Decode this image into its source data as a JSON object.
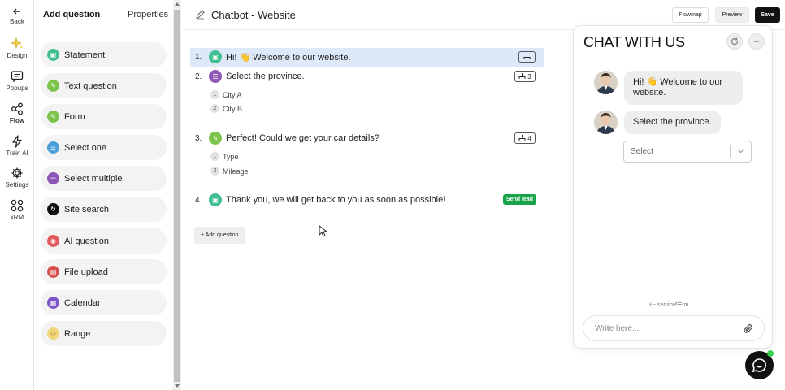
{
  "rail": {
    "back": "Back",
    "items": [
      {
        "label": "Design",
        "icon": "sparkle-icon"
      },
      {
        "label": "Popups",
        "icon": "chat-icon"
      },
      {
        "label": "Flow",
        "icon": "share-icon"
      },
      {
        "label": "Train AI",
        "icon": "bolt-icon"
      },
      {
        "label": "Settings",
        "icon": "gear-icon"
      },
      {
        "label": "xRM",
        "icon": "grid-icon"
      }
    ]
  },
  "palette": {
    "tab_add": "Add question",
    "tab_properties": "Properties",
    "items": [
      {
        "label": "Statement",
        "color": "#3fbf8f"
      },
      {
        "label": "Text question",
        "color": "#7cc34c"
      },
      {
        "label": "Form",
        "color": "#7cc34c"
      },
      {
        "label": "Select one",
        "color": "#4a9fd8"
      },
      {
        "label": "Select multiple",
        "color": "#8e57b5"
      },
      {
        "label": "Site search",
        "color": "#111111"
      },
      {
        "label": "AI question",
        "color": "#e05a5a"
      },
      {
        "label": "File upload",
        "color": "#d6504d"
      },
      {
        "label": "Calendar",
        "color": "#7b55c7"
      },
      {
        "label": "Range",
        "color": "#f0d77a"
      }
    ]
  },
  "header": {
    "title": "Chatbot - Website",
    "flowmap": "Flowmap",
    "preview": "Preview",
    "save": "Save"
  },
  "editor": {
    "questions": [
      {
        "num": "1.",
        "text": "Hi! 👋 Welcome to our website.",
        "badge": "",
        "color": "#3fbf8f"
      },
      {
        "num": "2.",
        "text": "Select the province.",
        "badge": "3",
        "color": "#8e57b5",
        "options": [
          {
            "n": "1",
            "label": "City A"
          },
          {
            "n": "2",
            "label": "City B"
          }
        ]
      },
      {
        "num": "3.",
        "text": "Perfect! Could we get your car details?",
        "badge": "4",
        "color": "#7cc34c",
        "options": [
          {
            "n": "1",
            "label": "Type"
          },
          {
            "n": "2",
            "label": "Mileage"
          }
        ]
      },
      {
        "num": "4.",
        "text": "Thank you, we will get back to you as soon as possible!",
        "send": "Send lead",
        "color": "#3fbf8f"
      }
    ],
    "add_question": "+ Add question"
  },
  "chat": {
    "title": "CHAT WITH US",
    "messages": [
      "Hi! 👋 Welcome to our website.",
      "Select the province."
    ],
    "select_placeholder": "Select",
    "powered": "⚡~ servicef☰rm",
    "input_placeholder": "Write here..."
  }
}
